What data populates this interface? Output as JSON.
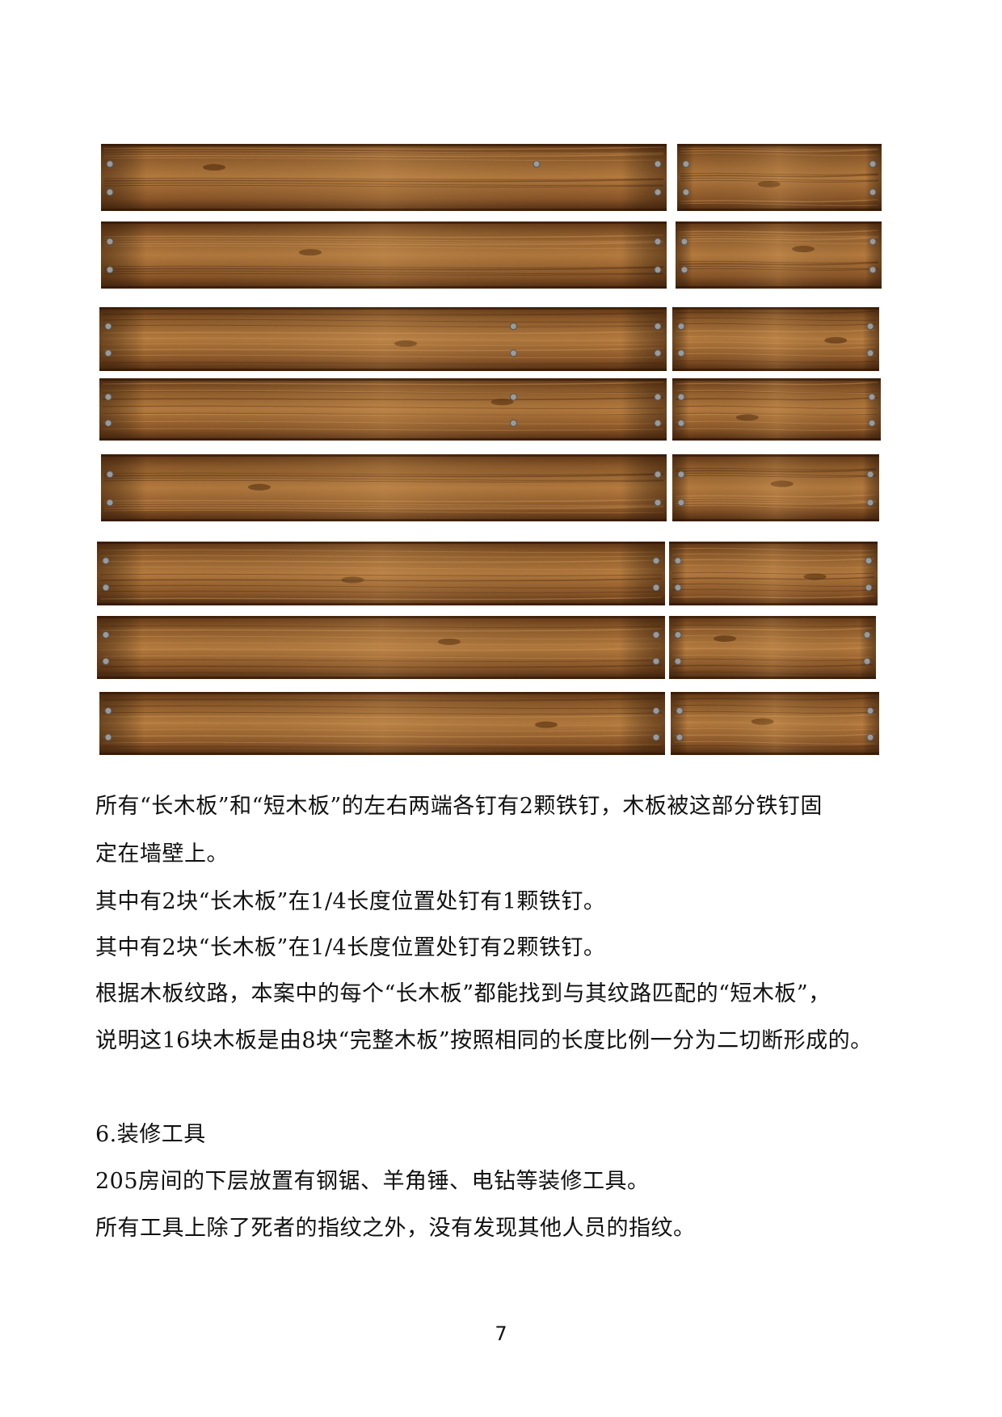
{
  "figure": {
    "description_name": "wooden-planks-photo",
    "rows": 8,
    "pieces_per_row": 2,
    "wood_color": "#8a5a2b",
    "nail_color": "#9a9a9a"
  },
  "paragraphs": {
    "p1_line1": "所有“长木板”和“短木板”的左右两端各钉有2颗铁钉，木板被这部分铁钉固",
    "p1_line2": "定在墙壁上。",
    "p2": "其中有2块“长木板”在1/4长度位置处钉有1颗铁钉。",
    "p3": "其中有2块“长木板”在1/4长度位置处钉有2颗铁钉。",
    "p4_line1": "根据木板纹路，本案中的每个“长木板”都能找到与其纹路匹配的“短木板”，",
    "p4_line2": "说明这16块木板是由8块“完整木板”按照相同的长度比例一分为二切断形成的。"
  },
  "section6": {
    "heading": "6.装修工具",
    "p1": "205房间的下层放置有钢锯、羊角锤、电钻等装修工具。",
    "p2": "所有工具上除了死者的指纹之外，没有发现其他人员的指纹。"
  },
  "page_number": "7"
}
